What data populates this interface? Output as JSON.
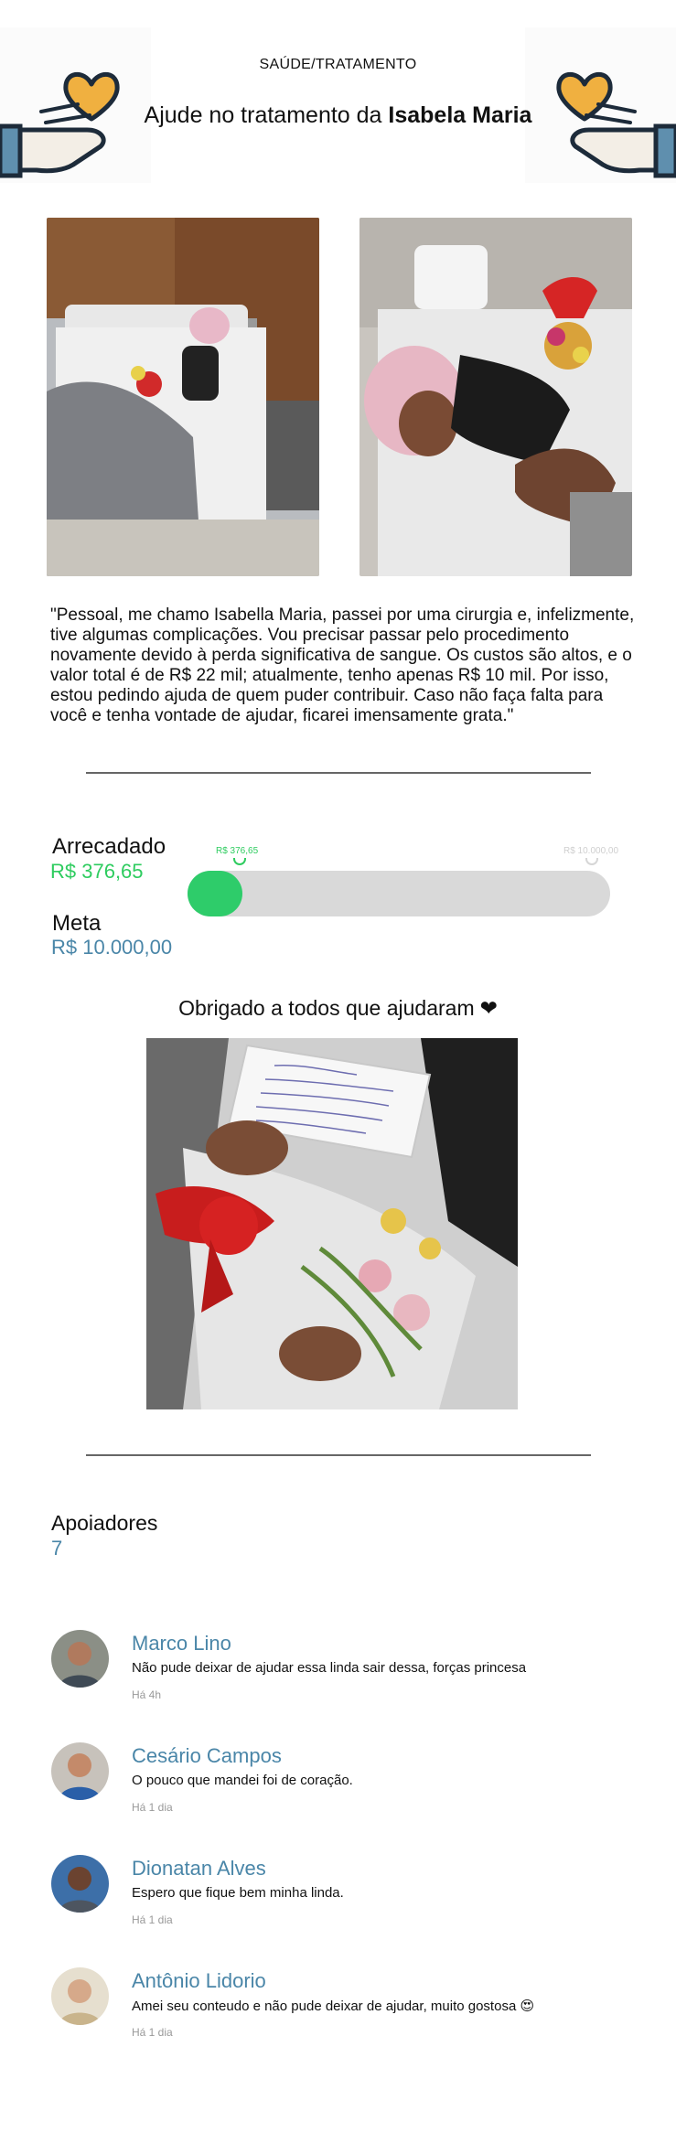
{
  "header": {
    "category": "SAÚDE/TRATAMENTO",
    "title_prefix": "Ajude no tratamento da",
    "title_name": "Isabela Maria"
  },
  "story": "\"Pessoal, me chamo Isabella Maria, passei por uma cirurgia e, infelizmente, tive algumas complicações. Vou precisar passar pelo procedimento novamente devido à perda significativa de sangue. Os custos são altos, e o valor total é de R$ 22 mil; atualmente, tenho apenas R$ 10 mil. Por isso, estou pedindo ajuda de quem puder contribuir. Caso não faça falta para você e tenha vontade de ajudar, ficarei imensamente grata.\"",
  "fundraising": {
    "raised_label": "Arrecadado",
    "raised_value": "R$ 376,65",
    "goal_label": "Meta",
    "goal_value": "R$ 10.000,00",
    "progress_min_label": "R$ 376,65",
    "progress_max_label": "R$ 10.000,00",
    "progress_fraction": 0.0377
  },
  "thanks": {
    "text": "Obrigado a todos que ajudaram",
    "heart": "❤"
  },
  "supporters": {
    "label": "Apoiadores",
    "count": "7",
    "items": [
      {
        "name": "Marco Lino",
        "message": "Não pude deixar de ajudar essa linda sair dessa, forças princesa",
        "time": "Há 4h"
      },
      {
        "name": "Cesário Campos",
        "message": "O pouco que mandei foi de coração.",
        "time": "Há 1 dia"
      },
      {
        "name": "Dionatan Alves",
        "message": "Espero que fique bem minha linda.",
        "time": "Há 1 dia"
      },
      {
        "name": "Antônio Lidorio",
        "message": "Amei seu conteudo e não pude deixar de ajudar, muito gostosa 😍",
        "time": "Há 1 dia"
      }
    ]
  },
  "colors": {
    "raised": "#2ecc5f",
    "goal": "#4a86a8",
    "progress_track": "#d9d9d9",
    "heart_icon": "#f0b040",
    "hand_outline": "#1d2b3a",
    "cuff": "#5f8fae"
  }
}
